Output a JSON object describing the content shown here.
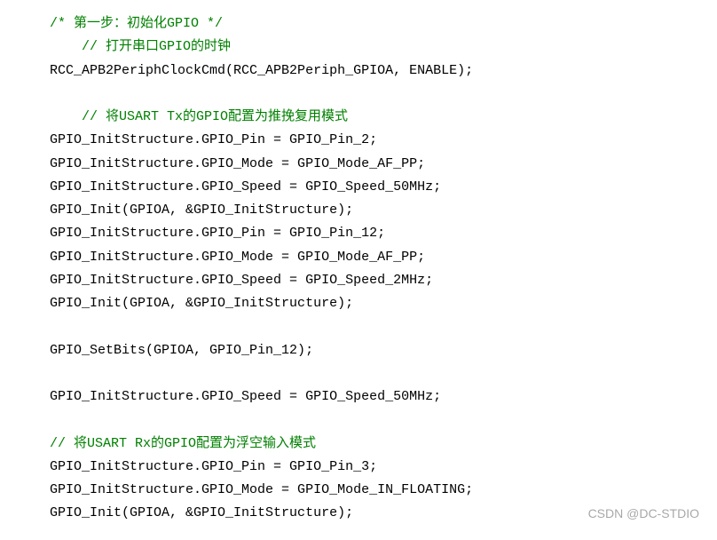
{
  "lines": [
    {
      "indent": 1,
      "segments": [
        {
          "type": "comment",
          "text": "/* 第一步：初始化GPIO */"
        }
      ]
    },
    {
      "indent": 2,
      "segments": [
        {
          "type": "comment",
          "text": "// 打开串口GPIO的时钟"
        }
      ]
    },
    {
      "indent": 1,
      "segments": [
        {
          "type": "code",
          "text": "RCC_APB2PeriphClockCmd(RCC_APB2Periph_GPIOA, ENABLE);"
        }
      ]
    },
    {
      "indent": 0,
      "segments": []
    },
    {
      "indent": 2,
      "segments": [
        {
          "type": "comment",
          "text": "// 将USART Tx的GPIO配置为推挽复用模式"
        }
      ]
    },
    {
      "indent": 1,
      "segments": [
        {
          "type": "code",
          "text": "GPIO_InitStructure.GPIO_Pin = GPIO_Pin_2;"
        }
      ]
    },
    {
      "indent": 1,
      "segments": [
        {
          "type": "code",
          "text": "GPIO_InitStructure.GPIO_Mode = GPIO_Mode_AF_PP;"
        }
      ]
    },
    {
      "indent": 1,
      "segments": [
        {
          "type": "code",
          "text": "GPIO_InitStructure.GPIO_Speed = GPIO_Speed_50MHz;"
        }
      ]
    },
    {
      "indent": 1,
      "segments": [
        {
          "type": "code",
          "text": "GPIO_Init(GPIOA, &GPIO_InitStructure);"
        }
      ]
    },
    {
      "indent": 1,
      "segments": [
        {
          "type": "code",
          "text": "GPIO_InitStructure.GPIO_Pin = GPIO_Pin_12;"
        }
      ]
    },
    {
      "indent": 1,
      "segments": [
        {
          "type": "code",
          "text": "GPIO_InitStructure.GPIO_Mode = GPIO_Mode_AF_PP;"
        }
      ]
    },
    {
      "indent": 1,
      "segments": [
        {
          "type": "code",
          "text": "GPIO_InitStructure.GPIO_Speed = GPIO_Speed_2MHz;"
        }
      ]
    },
    {
      "indent": 1,
      "segments": [
        {
          "type": "code",
          "text": "GPIO_Init(GPIOA, &GPIO_InitStructure);"
        }
      ]
    },
    {
      "indent": 0,
      "segments": []
    },
    {
      "indent": 1,
      "segments": [
        {
          "type": "code",
          "text": "GPIO_SetBits(GPIOA, GPIO_Pin_12);"
        }
      ]
    },
    {
      "indent": 0,
      "segments": []
    },
    {
      "indent": 1,
      "segments": [
        {
          "type": "code",
          "text": "GPIO_InitStructure.GPIO_Speed = GPIO_Speed_50MHz;"
        }
      ]
    },
    {
      "indent": 0,
      "segments": []
    },
    {
      "indent": 1,
      "segments": [
        {
          "type": "comment",
          "text": "// 将USART Rx的GPIO配置为浮空输入模式"
        }
      ]
    },
    {
      "indent": 1,
      "segments": [
        {
          "type": "code",
          "text": "GPIO_InitStructure.GPIO_Pin = GPIO_Pin_3;"
        }
      ]
    },
    {
      "indent": 1,
      "segments": [
        {
          "type": "code",
          "text": "GPIO_InitStructure.GPIO_Mode = GPIO_Mode_IN_FLOATING;"
        }
      ]
    },
    {
      "indent": 1,
      "segments": [
        {
          "type": "code",
          "text": "GPIO_Init(GPIOA, &GPIO_InitStructure);"
        }
      ]
    }
  ],
  "watermark": "CSDN @DC-STDIO"
}
